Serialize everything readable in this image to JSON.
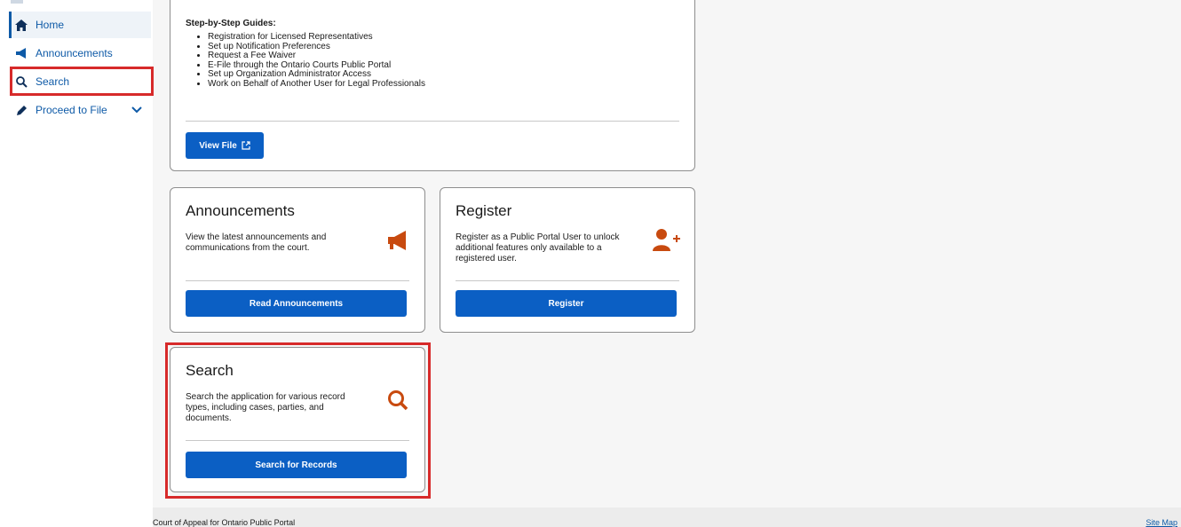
{
  "sidebar": {
    "items": [
      {
        "label": "Home",
        "icon": "home-icon"
      },
      {
        "label": "Announcements",
        "icon": "megaphone-icon"
      },
      {
        "label": "Search",
        "icon": "search-icon"
      },
      {
        "label": "Proceed to File",
        "icon": "pencil-icon"
      }
    ]
  },
  "guides": {
    "title": "Step-by-Step Guides:",
    "items": [
      "Registration for Licensed Representatives",
      "Set up Notification Preferences",
      "Request a Fee Waiver",
      "E-File through the Ontario Courts Public Portal",
      "Set up Organization Administrator Access",
      "Work on Behalf of Another User for Legal Professionals"
    ],
    "button": "View File"
  },
  "cards": {
    "announcements": {
      "title": "Announcements",
      "desc": "View the latest announcements and communications from the court.",
      "button": "Read Announcements",
      "icon": "megaphone-icon"
    },
    "register": {
      "title": "Register",
      "desc": "Register as a Public Portal User to unlock additional features only available to a registered user.",
      "button": "Register",
      "icon": "add-user-icon"
    },
    "search": {
      "title": "Search",
      "desc": "Search the application for various record types, including cases, parties, and documents.",
      "button": "Search for Records",
      "icon": "search-icon"
    }
  },
  "footer": {
    "left": "Court of Appeal for Ontario Public Portal",
    "right": "Site Map"
  },
  "colors": {
    "accent": "#0b5fc4",
    "icon_orange": "#c84a0f",
    "highlight": "#d72a2a"
  }
}
